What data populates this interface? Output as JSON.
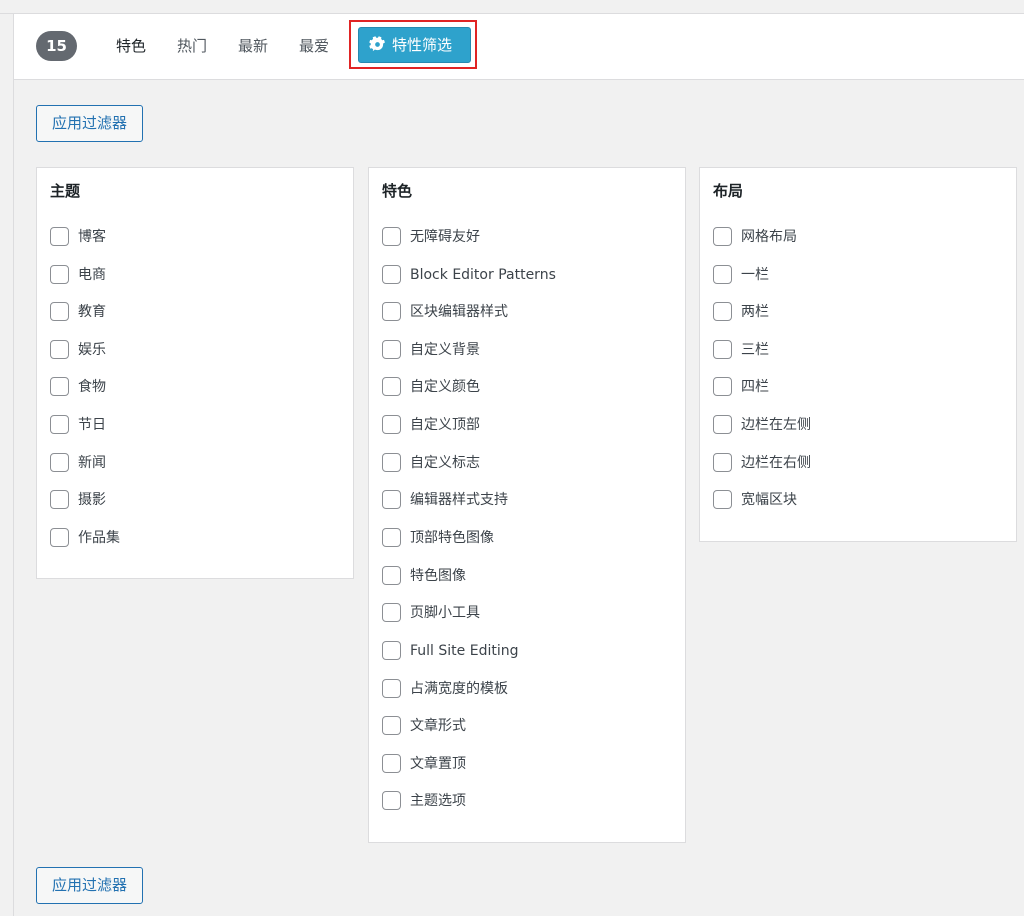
{
  "filter_bar": {
    "count": "15",
    "tabs": [
      "特色",
      "热门",
      "最新",
      "最爱"
    ],
    "feature_filter_label": "特性筛选"
  },
  "apply_label": "应用过滤器",
  "groups": [
    {
      "title": "主题",
      "options": [
        "博客",
        "电商",
        "教育",
        "娱乐",
        "食物",
        "节日",
        "新闻",
        "摄影",
        "作品集"
      ]
    },
    {
      "title": "特色",
      "options": [
        "无障碍友好",
        "Block Editor Patterns",
        "区块编辑器样式",
        "自定义背景",
        "自定义颜色",
        "自定义顶部",
        "自定义标志",
        "编辑器样式支持",
        "顶部特色图像",
        "特色图像",
        "页脚小工具",
        "Full Site Editing",
        "占满宽度的模板",
        "文章形式",
        "文章置顶",
        "主题选项"
      ]
    },
    {
      "title": "布局",
      "options": [
        "网格布局",
        "一栏",
        "两栏",
        "三栏",
        "四栏",
        "边栏在左侧",
        "边栏在右侧",
        "宽幅区块"
      ]
    }
  ],
  "colors": {
    "accent": "#2ea2cc",
    "link": "#2271b1",
    "highlight_border": "#e02424",
    "count_badge": "#646970"
  }
}
